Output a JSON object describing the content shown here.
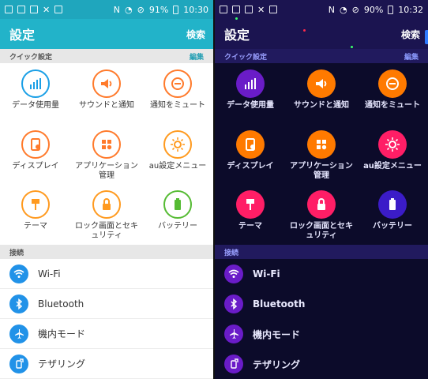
{
  "left": {
    "status": {
      "battery": "91%",
      "time": "10:30"
    },
    "appbar": {
      "title": "設定",
      "search": "検索"
    },
    "quick": {
      "header": "クイック設定",
      "edit": "編集"
    },
    "tiles": [
      {
        "label": "データ使用量",
        "icon": "data-usage-icon",
        "color": "#1a9fe6"
      },
      {
        "label": "サウンドと通知",
        "icon": "speaker-icon",
        "color": "#ff7a2b"
      },
      {
        "label": "通知をミュート",
        "icon": "mute-icon",
        "color": "#ff7a2b"
      },
      {
        "label": "ディスプレイ",
        "icon": "display-icon",
        "color": "#ff7a2b"
      },
      {
        "label": "アプリケーション管理",
        "icon": "apps-icon",
        "color": "#ff7a2b"
      },
      {
        "label": "au設定メニュー",
        "icon": "sun-icon",
        "color": "#ff9a1f"
      },
      {
        "label": "テーマ",
        "icon": "brush-icon",
        "color": "#ff9a1f"
      },
      {
        "label": "ロック画面とセキュリティ",
        "icon": "lock-icon",
        "color": "#ff9a1f"
      },
      {
        "label": "バッテリー",
        "icon": "battery-icon",
        "color": "#55bb33"
      }
    ],
    "connections": {
      "header": "接続"
    },
    "rows": [
      {
        "label": "Wi-Fi",
        "icon": "wifi-icon"
      },
      {
        "label": "Bluetooth",
        "icon": "bluetooth-icon"
      },
      {
        "label": "機内モード",
        "icon": "airplane-icon"
      },
      {
        "label": "テザリング",
        "icon": "tethering-icon"
      }
    ]
  },
  "right": {
    "status": {
      "battery": "90%",
      "time": "10:32"
    },
    "appbar": {
      "title": "設定",
      "search": "検索"
    },
    "quick": {
      "header": "クイック設定",
      "edit": "編集"
    },
    "tiles": [
      {
        "label": "データ使用量",
        "icon": "data-usage-icon",
        "color": "#6a1cc8"
      },
      {
        "label": "サウンドと通知",
        "icon": "speaker-icon",
        "color": "#ff7a00"
      },
      {
        "label": "通知をミュート",
        "icon": "mute-icon",
        "color": "#ff7a00"
      },
      {
        "label": "ディスプレイ",
        "icon": "display-icon",
        "color": "#ff7a00"
      },
      {
        "label": "アプリケーション管理",
        "icon": "apps-icon",
        "color": "#ff7a00"
      },
      {
        "label": "au設定メニュー",
        "icon": "sun-icon",
        "color": "#ff1e66"
      },
      {
        "label": "テーマ",
        "icon": "brush-icon",
        "color": "#ff1e66"
      },
      {
        "label": "ロック画面とセキュリティ",
        "icon": "lock-icon",
        "color": "#ff1e66"
      },
      {
        "label": "バッテリー",
        "icon": "battery-icon",
        "color": "#3b1cc8"
      }
    ],
    "connections": {
      "header": "接続"
    },
    "rows": [
      {
        "label": "Wi-Fi",
        "icon": "wifi-icon"
      },
      {
        "label": "Bluetooth",
        "icon": "bluetooth-icon"
      },
      {
        "label": "機内モード",
        "icon": "airplane-icon"
      },
      {
        "label": "テザリング",
        "icon": "tethering-icon"
      }
    ]
  }
}
